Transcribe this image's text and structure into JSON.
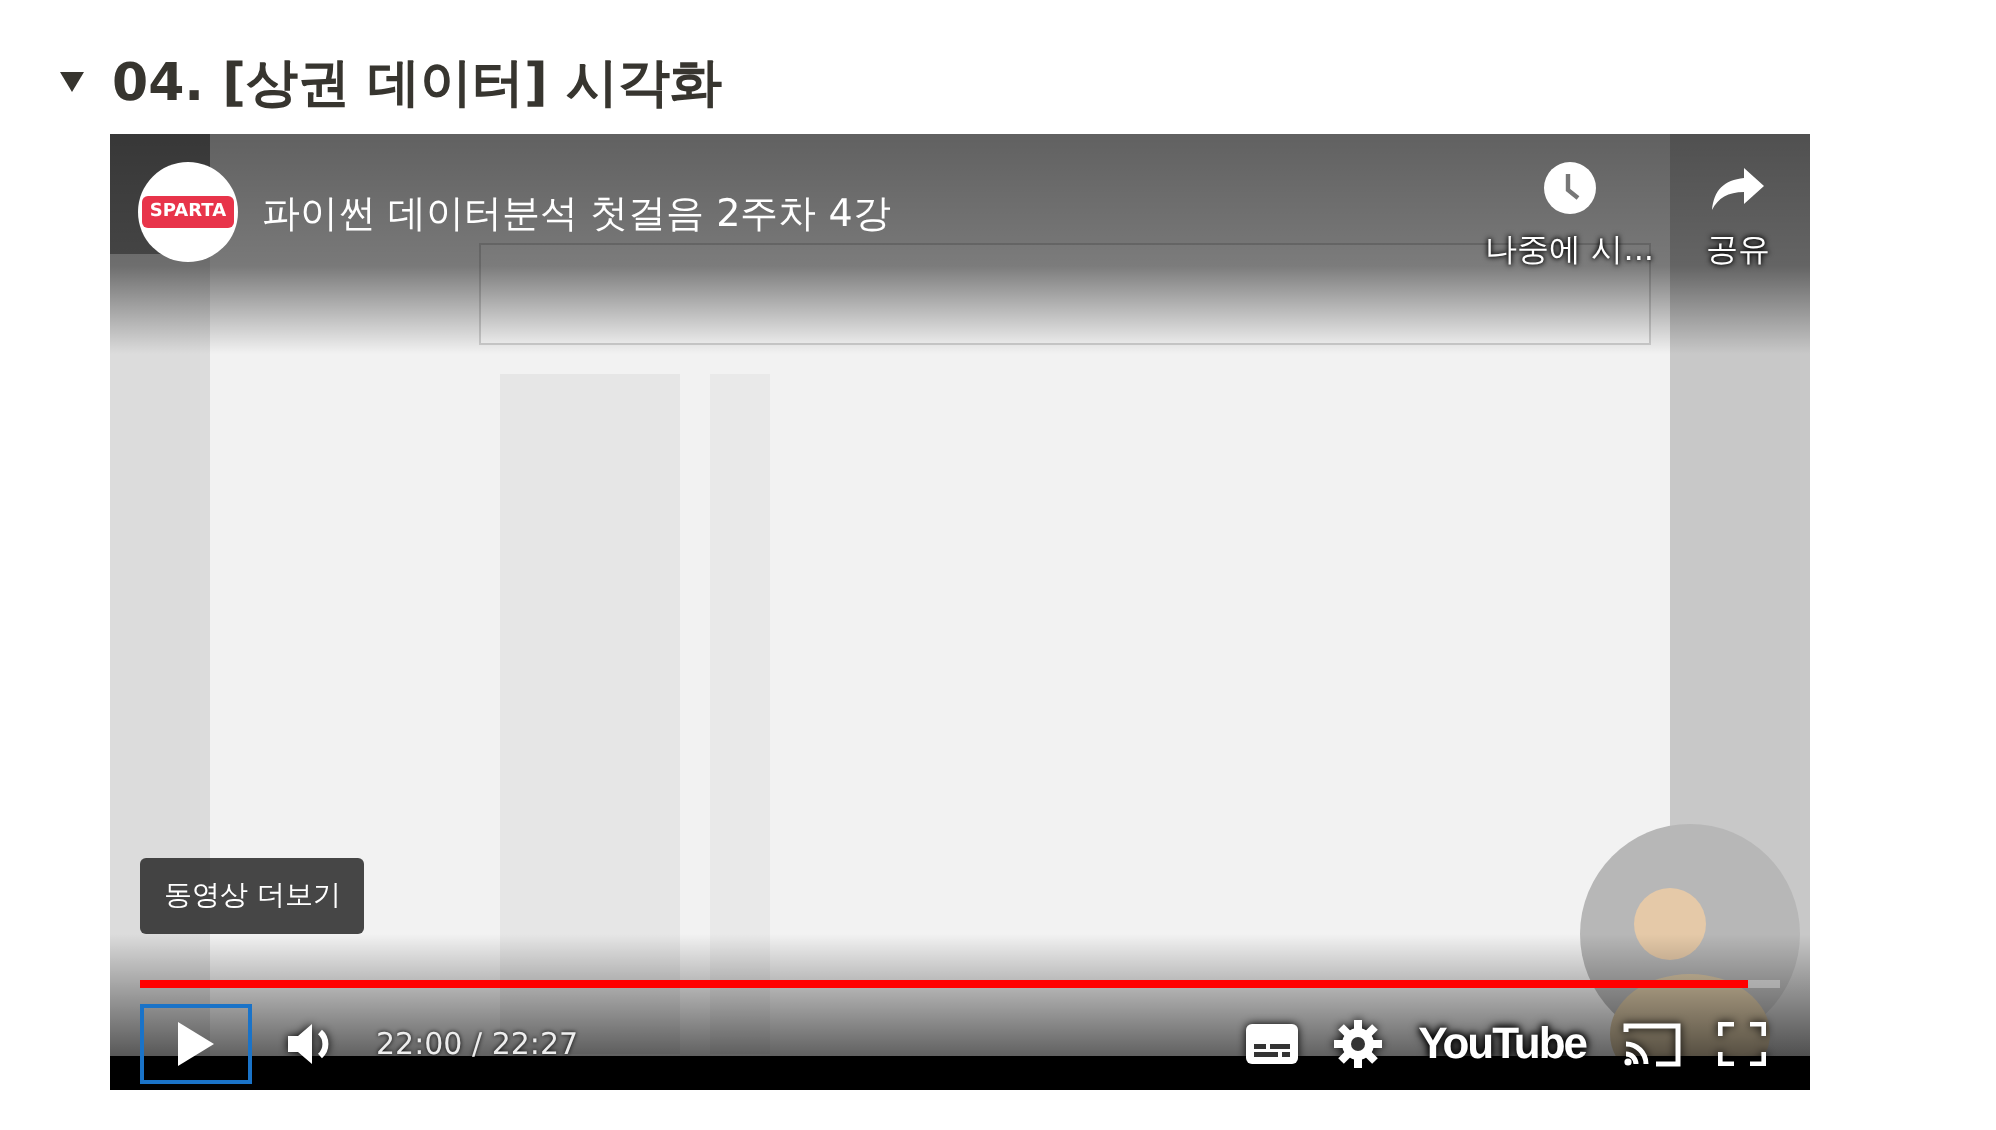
{
  "section": {
    "expanded": true,
    "title": "04. [상권 데이터] 시각화"
  },
  "video": {
    "kind": "picture",
    "channel_logo": "SPARTA",
    "title": "파이썬 데이터분석 첫걸음 2주차 4강",
    "actions": [
      {
        "kind": "clock",
        "label": "나중에 시..."
      },
      {
        "kind": "share",
        "label": "공유"
      }
    ],
    "more_videos": "동영상 더보기",
    "progress": {
      "level": 0.98
    },
    "playing": false,
    "time": "22:00 / 22:27",
    "brand": "YouTube"
  }
}
